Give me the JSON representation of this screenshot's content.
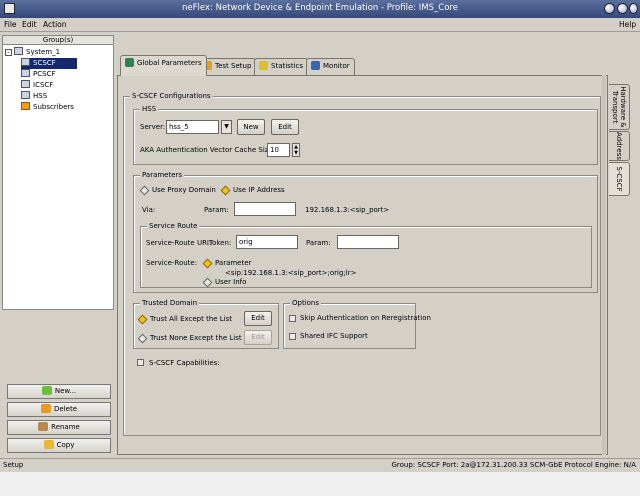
{
  "window": {
    "title": "neFlex: Network Device & Endpoint Emulation - Profile: IMS_Core"
  },
  "menu": {
    "file": "File",
    "edit": "Edit",
    "action": "Action",
    "help": "Help"
  },
  "groups": {
    "header": "Group(s)",
    "system": "System_1",
    "items": [
      "SCSCF",
      "PCSCF",
      "ICSCF",
      "HSS",
      "Subscribers"
    ],
    "selected": "SCSCF"
  },
  "side_buttons": {
    "new": "New...",
    "delete": "Delete",
    "rename": "Rename",
    "copy": "Copy"
  },
  "tabs": [
    "Global Parameters",
    "Test Setup",
    "Statistics",
    "Monitor"
  ],
  "vertical_tabs": [
    "Hardware & Transport",
    "Address",
    "S-CSCF"
  ],
  "config": {
    "title": "S-CSCF Configurations",
    "hss": {
      "title": "HSS",
      "server_label": "Server:",
      "server_value": "hss_5",
      "new_button": "New",
      "edit_button": "Edit",
      "aka_label": "AKA Authentication Vector Cache Size",
      "aka_value": "10"
    },
    "parameters": {
      "title": "Parameters",
      "use_proxy_domain": "Use Proxy Domain",
      "use_ip_address": "Use IP Address",
      "via_label": "Via:",
      "param_label": "Param:",
      "param_value": "",
      "via_address": "192.168.1.3:<sip_port>"
    },
    "service_route": {
      "title": "Service Route",
      "uri_label": "Service-Route URI:",
      "token_label": "Token:",
      "token_value": "orig",
      "param_label": "Param:",
      "param_value": "",
      "route_label": "Service-Route:",
      "parameter_option": "Parameter",
      "parameter_value": "<sip:192.168.1.3:<sip_port>;orig;lr>",
      "user_info_option": "User Info"
    },
    "trusted_domain": {
      "title": "Trusted Domain",
      "trust_all": "Trust All Except the List",
      "trust_none": "Trust None Except the List",
      "edit1": "Edit",
      "edit2": "Edit"
    },
    "options": {
      "title": "Options",
      "skip_auth": "Skip Authentication on Reregistration",
      "shared_ifc": "Shared IFC Support"
    },
    "capabilities": "S-CSCF Capabilities:"
  },
  "status": {
    "left": "Setup",
    "right": "Group: SCSCF Port: 2a@172.31.200.33 SCM-GbE Protocol Engine: N/A"
  },
  "colors": {
    "titlebar": "#34487a",
    "selection": "#14286e",
    "radio_on": "#f2c020"
  }
}
